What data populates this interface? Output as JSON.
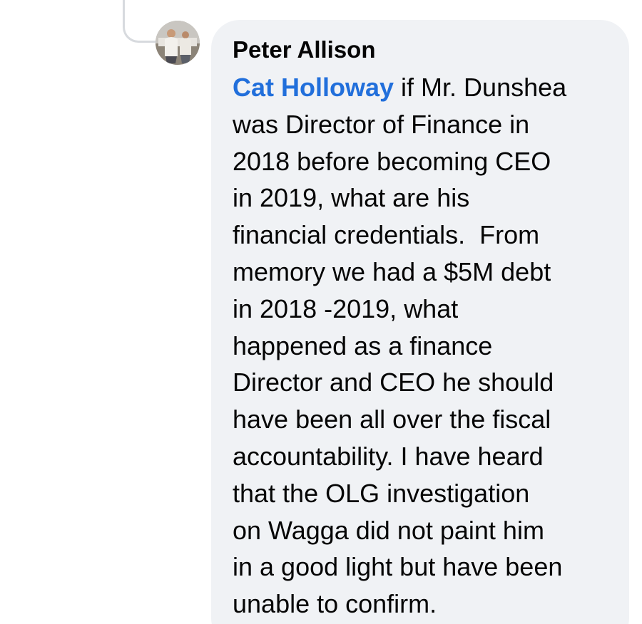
{
  "comment": {
    "author": "Peter Allison",
    "mention": "Cat Holloway",
    "first_line_rest": " if Mr. Dunshea",
    "lines": [
      "was Director of Finance in",
      "2018 before becoming CEO",
      "in 2019, what are his",
      "financial credentials.  From",
      "memory we had a $5M debt",
      "in 2018 -2019, what",
      "happened as a finance",
      "Director and CEO he should",
      "have been all over the fiscal",
      "accountability. I have heard",
      "that the OLG investigation",
      "on Wagga did not paint him",
      "in a good light but have been",
      "unable to confirm."
    ]
  },
  "colors": {
    "bubble_background": "#f0f2f5",
    "mention_link": "#216fdb",
    "text": "#050505",
    "thread_connector": "#d7dade"
  }
}
